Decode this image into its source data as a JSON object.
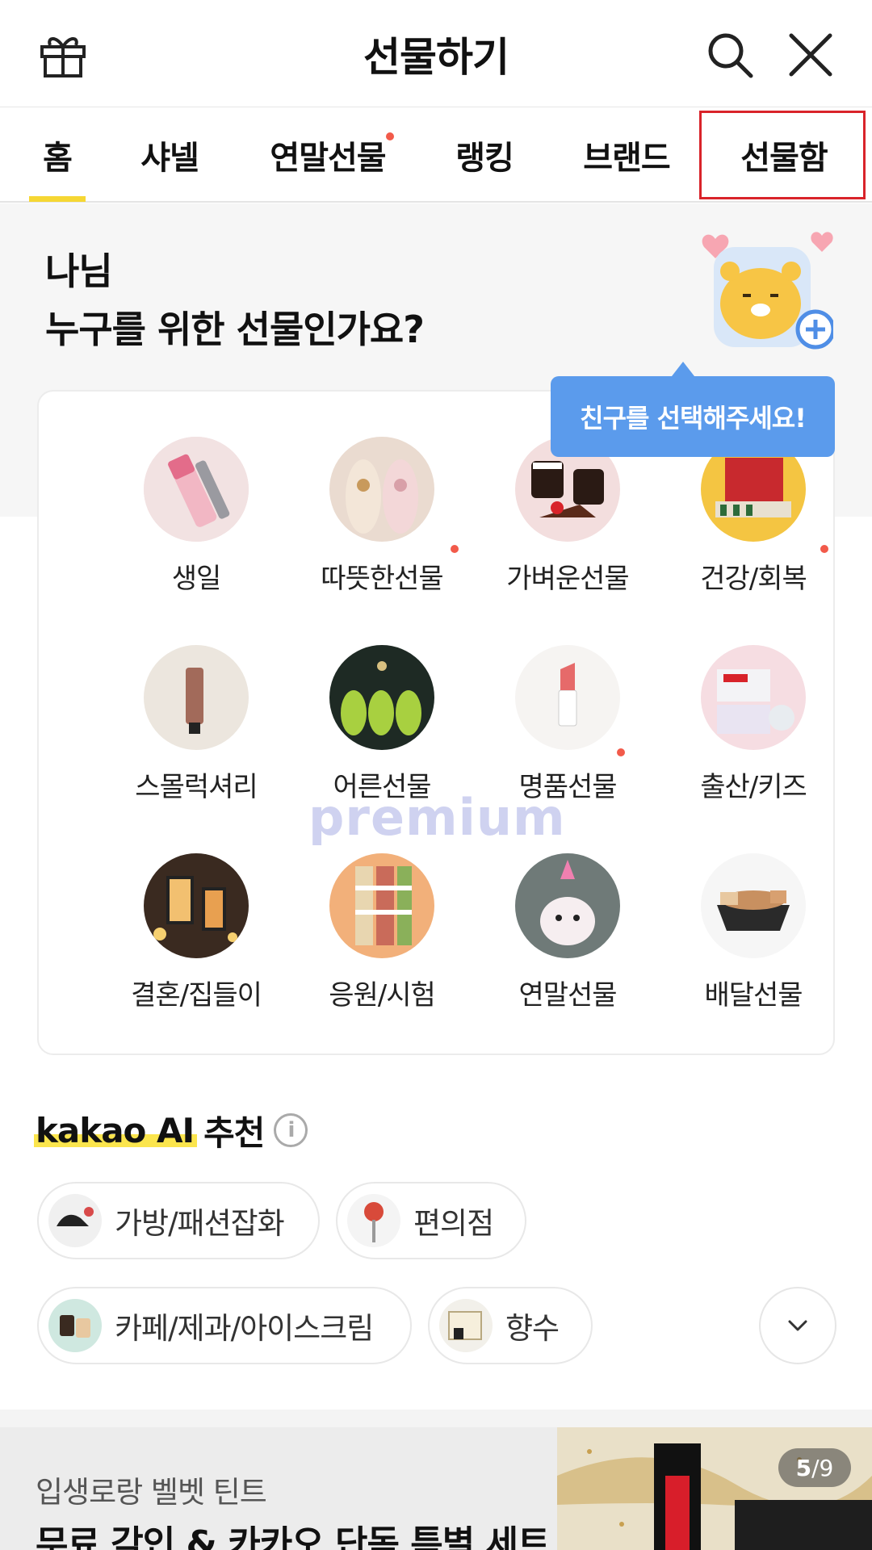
{
  "header": {
    "title": "선물하기"
  },
  "tabs": [
    {
      "label": "홈",
      "active": true,
      "has_dot": false
    },
    {
      "label": "샤넬",
      "active": false,
      "has_dot": false
    },
    {
      "label": "연말선물",
      "active": false,
      "has_dot": true
    },
    {
      "label": "랭킹",
      "active": false,
      "has_dot": false
    },
    {
      "label": "브랜드",
      "active": false,
      "has_dot": false
    },
    {
      "label": "선물함",
      "active": false,
      "has_dot": false,
      "highlighted": true
    }
  ],
  "intro": {
    "name": "나님",
    "question": "누구를 위한 선물인가요?",
    "tooltip": "친구를 선택해주세요!"
  },
  "categories": [
    {
      "label": "생일",
      "icon": "lipstick-pink",
      "has_dot": false
    },
    {
      "label": "따뜻한선물",
      "icon": "slippers",
      "has_dot": true
    },
    {
      "label": "가벼운선물",
      "icon": "coffee-cake",
      "has_dot": false
    },
    {
      "label": "건강/회복",
      "icon": "health-box",
      "has_dot": true
    },
    {
      "label": "스몰럭셔리",
      "icon": "hand-cream",
      "has_dot": false
    },
    {
      "label": "어른선물",
      "icon": "grapes-box",
      "has_dot": false
    },
    {
      "label": "명품선물",
      "icon": "lipstick-white",
      "has_dot": true
    },
    {
      "label": "출산/키즈",
      "icon": "diapers",
      "has_dot": false
    },
    {
      "label": "결혼/집들이",
      "icon": "lanterns",
      "has_dot": false
    },
    {
      "label": "응원/시험",
      "icon": "macarons",
      "has_dot": false
    },
    {
      "label": "연말선물",
      "icon": "puppy-party",
      "has_dot": false
    },
    {
      "label": "배달선물",
      "icon": "food-platter",
      "has_dot": false
    }
  ],
  "watermark": "premium",
  "ai": {
    "brand": "kakao AI",
    "label": "추천",
    "chips": [
      {
        "label": "가방/패션잡화",
        "icon": "caps"
      },
      {
        "label": "편의점",
        "icon": "lollipop"
      },
      {
        "label": "카페/제과/아이스크림",
        "icon": "cups"
      },
      {
        "label": "향수",
        "icon": "perfume-box"
      }
    ]
  },
  "banner": {
    "subtitle": "입생로랑 벨벳 틴트",
    "title": "무료 각인 & 카카오 단독 특별 세트",
    "page_current": "5",
    "page_total": "/9"
  },
  "colors": {
    "accent_yellow": "#f6d733",
    "dot_red": "#f25a4a",
    "tooltip_blue": "#5b9bec",
    "highlight_red": "#d9232a"
  }
}
